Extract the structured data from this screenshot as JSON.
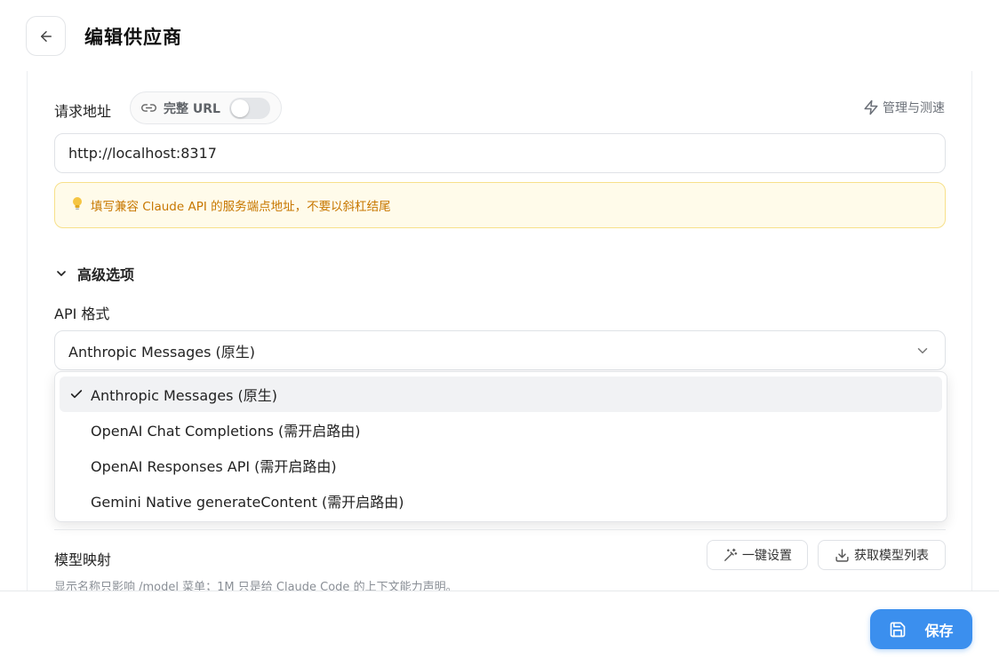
{
  "header": {
    "title": "编辑供应商"
  },
  "request": {
    "label": "请求地址",
    "full_url_label": "完整 URL",
    "full_url_on": false,
    "manage_label": "管理与测速",
    "url_value": "http://localhost:8317",
    "hint": "填写兼容 Claude API 的服务端点地址，不要以斜杠结尾"
  },
  "advanced": {
    "label": "高级选项",
    "api_format_label": "API 格式",
    "selected": "Anthropic Messages (原生)",
    "options": [
      "Anthropic Messages (原生)",
      "OpenAI Chat Completions (需开启路由)",
      "OpenAI Responses API (需开启路由)",
      "Gemini Native generateContent (需开启路由)"
    ]
  },
  "model_mapping": {
    "label": "模型映射",
    "one_click_label": "一键设置",
    "fetch_label": "获取模型列表",
    "description": "显示名称只影响 /model 菜单；1M 只是给 Claude Code 的上下文能力声明。"
  },
  "footer": {
    "save_label": "保存"
  },
  "colors": {
    "accent": "#3b8fee",
    "hint_bg": "#fffbea",
    "hint_text": "#c77700"
  }
}
